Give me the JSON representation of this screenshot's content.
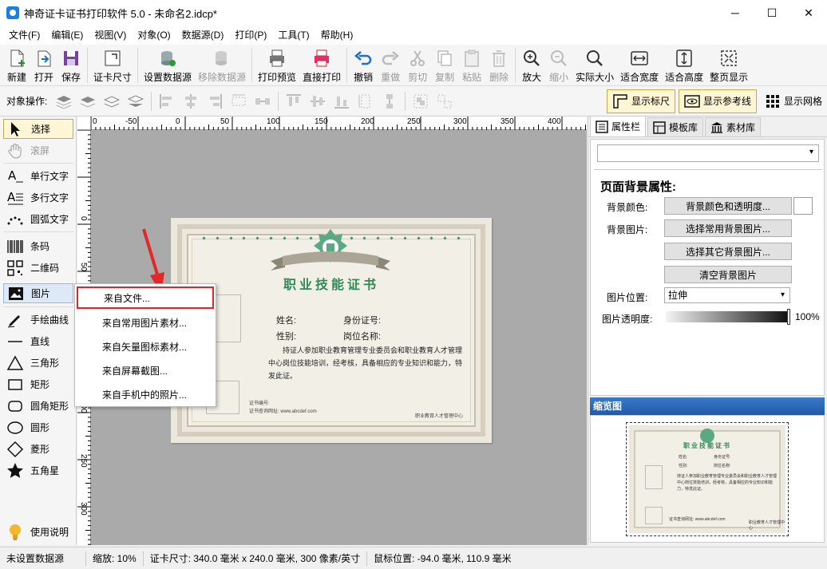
{
  "window": {
    "title": "神奇证卡证书打印软件 5.0 - 未命名2.idcp*",
    "minimize": "─",
    "maximize": "☐",
    "close": "✕"
  },
  "menubar": [
    "文件(F)",
    "编辑(E)",
    "视图(V)",
    "对象(O)",
    "数据源(D)",
    "打印(P)",
    "工具(T)",
    "帮助(H)"
  ],
  "toolbar": {
    "new": "新建",
    "open": "打开",
    "save": "保存",
    "card_size": "证卡尺寸",
    "set_datasource": "设置数据源",
    "remove_datasource": "移除数据源",
    "print_preview": "打印预览",
    "direct_print": "直接打印",
    "undo": "撤销",
    "redo": "重做",
    "cut": "剪切",
    "copy": "复制",
    "paste": "粘贴",
    "delete": "删除",
    "zoom_in": "放大",
    "zoom_out": "缩小",
    "actual_size": "实际大小",
    "fit_width": "适合宽度",
    "fit_height": "适合高度",
    "fit_page": "整页显示"
  },
  "objbar": {
    "label": "对象操作:",
    "show_ruler": "显示标尺",
    "show_guides": "显示参考线",
    "show_grid": "显示网格"
  },
  "leftpanel": {
    "select": "选择",
    "scroll": "滚屏",
    "single_text": "单行文字",
    "multi_text": "多行文字",
    "arc_text": "圆弧文字",
    "barcode": "条码",
    "qrcode": "二维码",
    "image": "图片",
    "freehand": "手绘曲线",
    "line": "直线",
    "triangle": "三角形",
    "rect": "矩形",
    "round_rect": "圆角矩形",
    "ellipse": "圆形",
    "diamond": "菱形",
    "star": "五角星",
    "help": "使用说明"
  },
  "ruler": {
    "top": [
      "0",
      "-50",
      "0",
      "50",
      "100",
      "150",
      "200",
      "250",
      "300",
      "350",
      "400"
    ],
    "left": [
      "0",
      "50",
      "100",
      "150",
      "200",
      "250",
      "300"
    ]
  },
  "certificate": {
    "title": "职业技能证书",
    "name_label": "姓名:",
    "id_label": "身份证号:",
    "gender_label": "性别:",
    "position_label": "岗位名称:",
    "body": "持证人参加职业教育管理专业委员会和职业教育人才管理中心岗位技能培训，经考核，具备相应的专业知识和能力，特发此证。",
    "cert_no": "证书编号:",
    "query_url": "证书查询网址: www.abcdef.com",
    "issuer": "职业教育人才管理中心"
  },
  "dropdown": {
    "from_file": "来自文件...",
    "from_common": "来自常用图片素材...",
    "from_vector": "来自矢量图标素材...",
    "from_screen": "来自屏幕截图...",
    "from_phone": "来自手机中的照片..."
  },
  "rightpanel": {
    "tabs": {
      "properties": "属性栏",
      "templates": "模板库",
      "assets": "素材库"
    },
    "heading": "页面背景属性:",
    "bg_color_label": "背景颜色:",
    "bg_color_btn": "背景颜色和透明度...",
    "bg_image_label": "背景图片:",
    "choose_common_bg": "选择常用背景图片...",
    "choose_other_bg": "选择其它背景图片...",
    "clear_bg": "清空背景图片",
    "image_pos_label": "图片位置:",
    "image_pos_value": "拉伸",
    "opacity_label": "图片透明度:",
    "opacity_value": "100%",
    "preview_head": "缩览图"
  },
  "statusbar": {
    "datasource": "未设置数据源",
    "zoom": "缩放: 10%",
    "card_size": "证卡尺寸: 340.0 毫米 x 240.0 毫米, 300 像素/英寸",
    "mouse_pos": "鼠标位置: -94.0 毫米, 110.9 毫米"
  },
  "colors": {
    "accent_blue": "#1f5aa8",
    "highlight_red": "#d9272e",
    "cert_green": "#2f8a55",
    "selected_yellow": "#fff6d5"
  }
}
